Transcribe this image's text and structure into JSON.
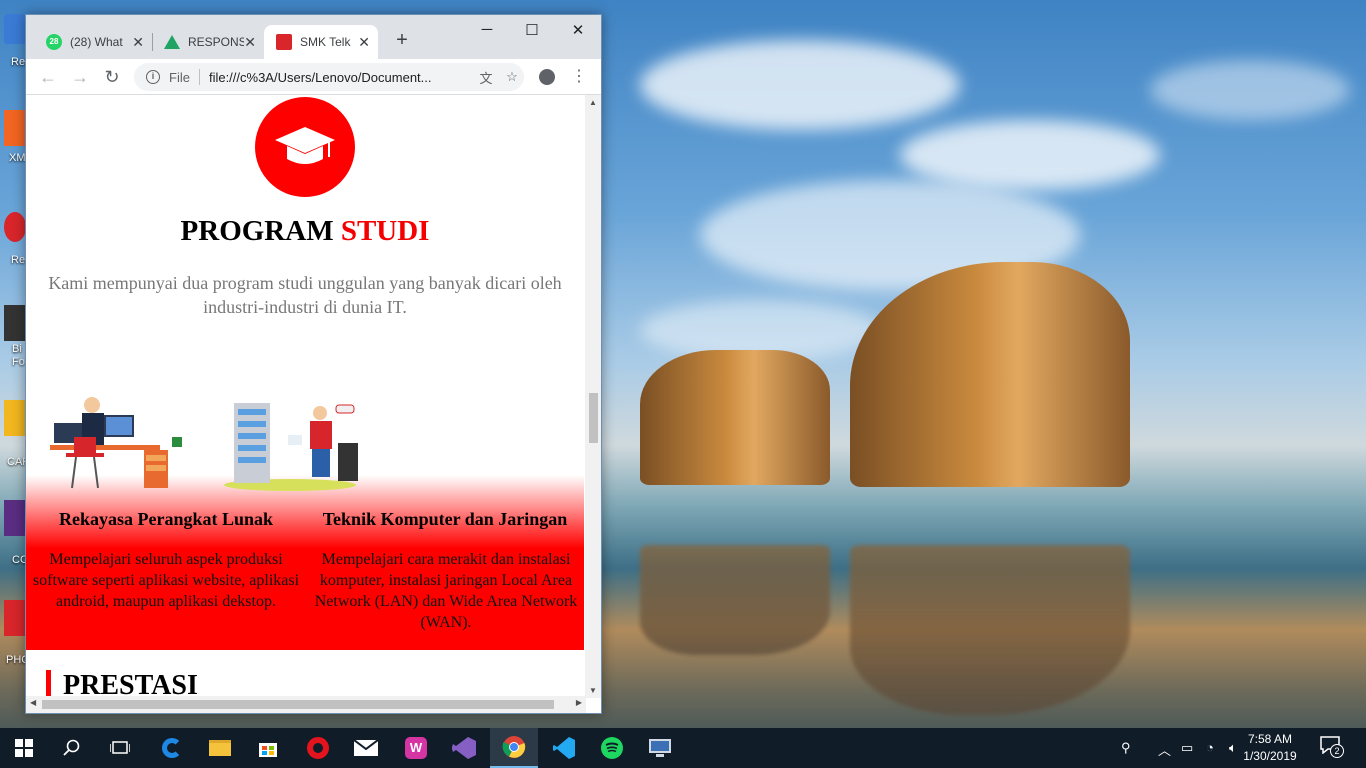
{
  "desktop": {
    "icons": [
      {
        "label": "Rec",
        "color": "#3a7bd5"
      },
      {
        "label": "XMi",
        "color": "#f26522"
      },
      {
        "label": "Rec",
        "color": "#d8262b"
      },
      {
        "label": "Bi\nFo",
        "color": "#333333"
      },
      {
        "label": "CAP",
        "color": "#f2b61f"
      },
      {
        "label": "CC",
        "color": "#5a2d82"
      },
      {
        "label": "PHC",
        "color": "#d8262b"
      }
    ]
  },
  "browser": {
    "tabs": [
      {
        "title": "(28) What",
        "favicon_badge": "28",
        "favicon_color": "#25d366",
        "active": false
      },
      {
        "title": "RESPONS",
        "favicon_color": "#1fa463",
        "active": false
      },
      {
        "title": "SMK Telk",
        "favicon_color": "#d8262b",
        "active": true
      }
    ],
    "new_tab": "+",
    "window_controls": {
      "minimize": "─",
      "maximize": "☐",
      "close": "✕"
    },
    "nav": {
      "back": "←",
      "forward": "→",
      "reload": "↻"
    },
    "address": {
      "info_glyph": "i",
      "scheme": "File",
      "url": "file:///c%3A/Users/Lenovo/Document..."
    },
    "toolbar_icons": [
      "translate-icon",
      "bookmark-star-icon",
      "account-icon",
      "menu-icon"
    ]
  },
  "page": {
    "title_main": "PROGRAM",
    "title_accent": "STUDI",
    "intro": "Kami mempunyai dua program studi unggulan yang banyak dicari oleh industri-industri di dunia IT.",
    "programs": [
      {
        "name": "Rekayasa Perangkat Lunak",
        "description": "Mempelajari seluruh aspek produksi software seperti aplikasi website, aplikasi android, maupun aplikasi dekstop."
      },
      {
        "name": "Teknik Komputer dan Jaringan",
        "description": "Mempelajari cara merakit dan instalasi komputer, instalasi jaringan Local Area Network (LAN) dan Wide Area Network (WAN)."
      }
    ],
    "next_section_title": "PRESTASI"
  },
  "taskbar": {
    "apps": [
      "start-icon",
      "search-icon",
      "task-view-icon",
      "edge-icon",
      "file-explorer-icon",
      "store-icon",
      "opera-icon",
      "mail-icon",
      "app-w-icon",
      "visual-studio-icon",
      "chrome-icon",
      "vscode-icon",
      "spotify-icon",
      "remote-desktop-icon"
    ],
    "active_app": "chrome-icon",
    "clock_time": "7:58 AM",
    "clock_date": "1/30/2019",
    "notification_count": "2"
  },
  "colors": {
    "accent_red": "#ff0000",
    "title_red": "#f40000",
    "taskbar": "#101c28"
  }
}
